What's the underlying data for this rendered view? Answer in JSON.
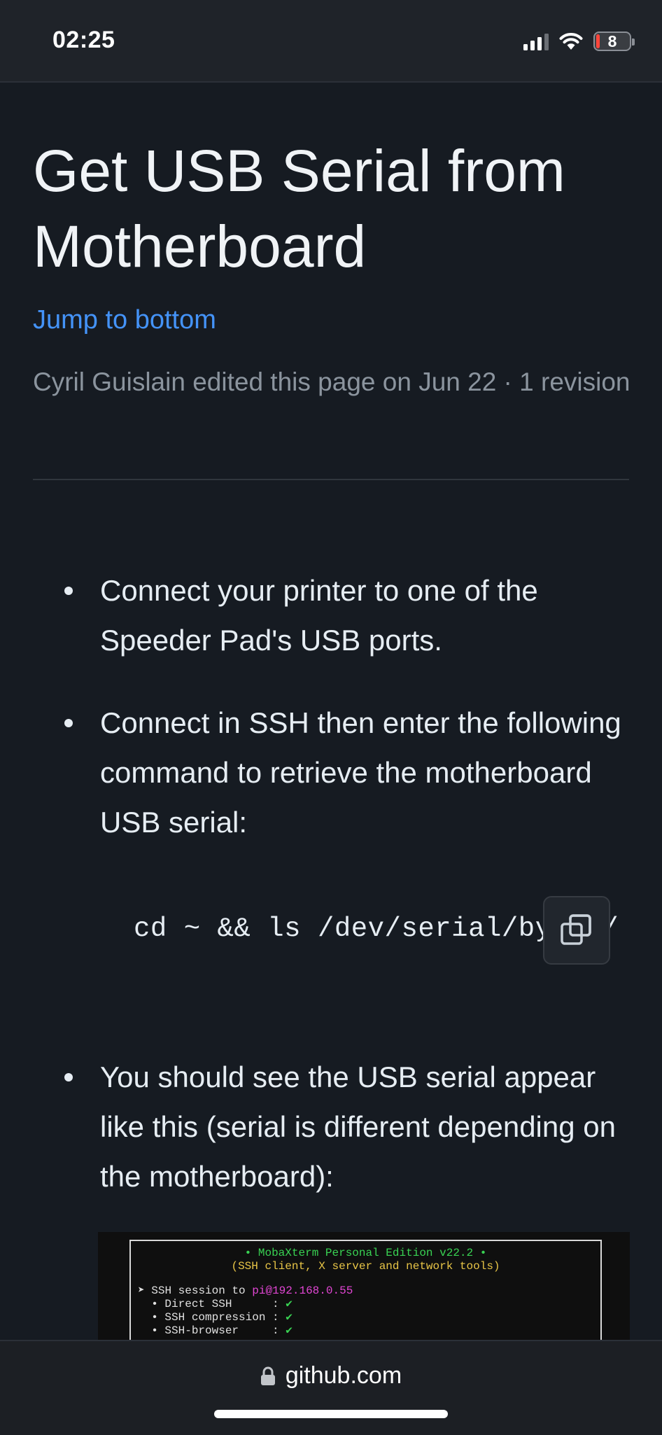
{
  "status_bar": {
    "time": "02:25",
    "battery_level": "8",
    "icons": [
      "cellular-signal-icon",
      "wifi-icon",
      "battery-icon"
    ]
  },
  "page": {
    "title": "Get USB Serial from Motherboard",
    "jump_link": "Jump to bottom",
    "edit_meta": "Cyril Guislain edited this page on Jun 22 · 1 revision",
    "bullets": [
      "Connect your printer to one of the Speeder Pad's USB ports.",
      "Connect in SSH then enter the following command to retrieve the motherboard USB serial:",
      "You should see the USB serial appear like this (serial is different depending on the motherboard):"
    ],
    "code": "cd ~ && ls /dev/serial/by-id/"
  },
  "terminal": {
    "line1": "• MobaXterm Personal Edition v22.2 •",
    "line2": "(SSH client, X server and network tools)",
    "session_prefix": "➤ SSH session to ",
    "session_host": "pi@192.168.0.55",
    "items": [
      {
        "label": "  • Direct SSH      :",
        "value": " ✔"
      },
      {
        "label": "  • SSH compression :",
        "value": " ✔"
      },
      {
        "label": "  • SSH-browser     :",
        "value": " ✔"
      }
    ]
  },
  "browser": {
    "url": "github.com"
  },
  "colors": {
    "background": "#161b22",
    "link": "#4493f8",
    "muted_text": "#8b949e",
    "battery_low": "#ff453a"
  }
}
